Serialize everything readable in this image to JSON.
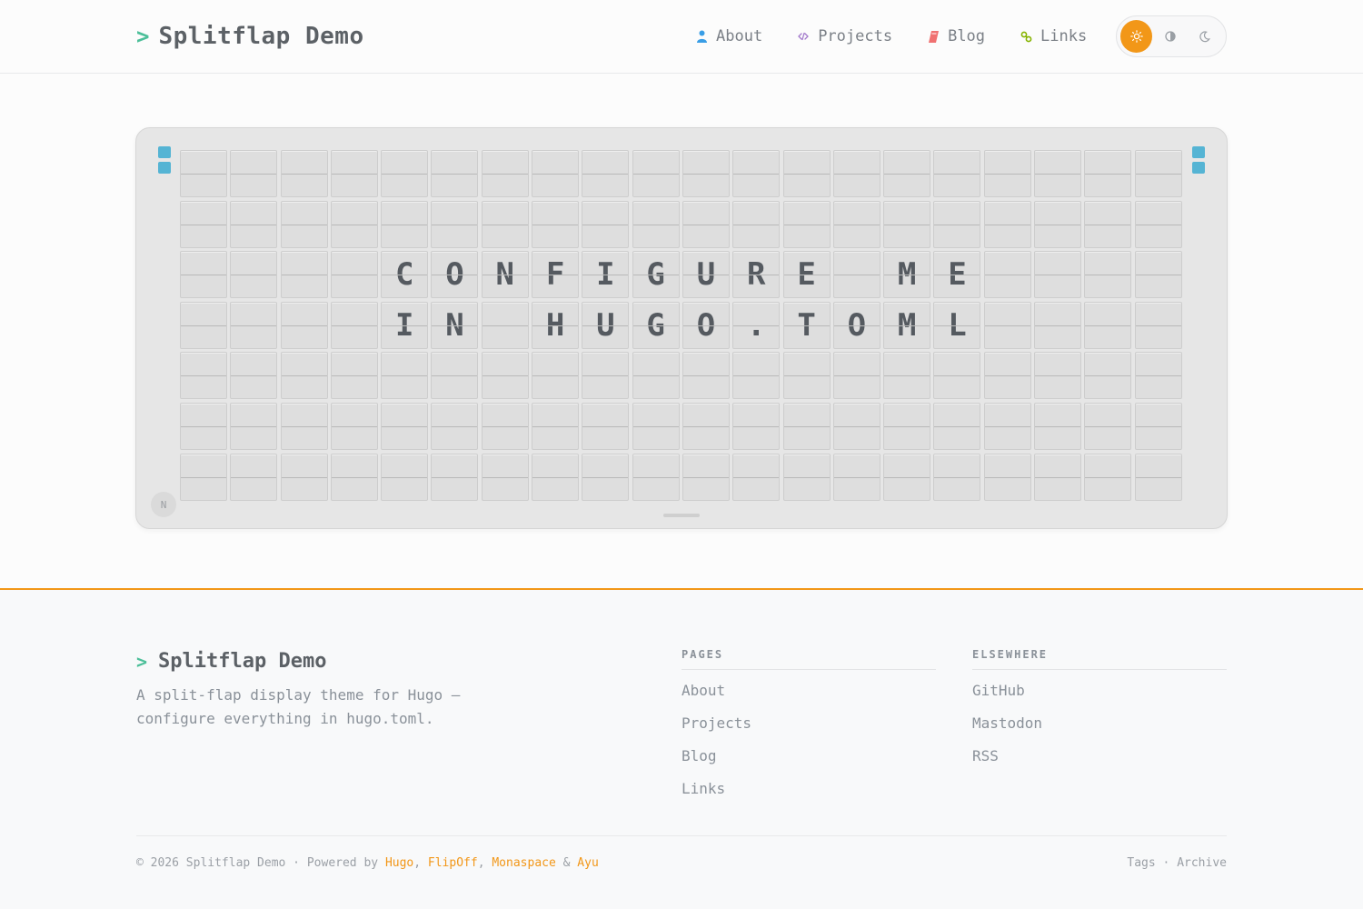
{
  "header": {
    "prompt": ">",
    "site_title": "Splitflap Demo",
    "nav": [
      {
        "label": "About",
        "icon": "person-icon",
        "color": "#399ee6"
      },
      {
        "label": "Projects",
        "icon": "code-icon",
        "color": "#a37acc"
      },
      {
        "label": "Blog",
        "icon": "notebook-icon",
        "color": "#f07171"
      },
      {
        "label": "Links",
        "icon": "link-icon",
        "color": "#86b300"
      }
    ],
    "theme_toggle": {
      "options": [
        "light",
        "auto",
        "dark"
      ],
      "selected": "light",
      "accent": "#f29718"
    }
  },
  "board": {
    "rows": [
      "                    ",
      "                    ",
      "    CONFIGURE ME    ",
      "    IN HUGO.TOML    ",
      "                    ",
      "                    ",
      "                    "
    ],
    "badge": "N",
    "led_color": "#55b4d4"
  },
  "footer": {
    "prompt": ">",
    "site_title": "Splitflap Demo",
    "description": "A split-flap display theme for Hugo — configure everything in hugo.toml.",
    "pages": {
      "heading": "PAGES",
      "items": [
        "About",
        "Projects",
        "Blog",
        "Links"
      ]
    },
    "elsewhere": {
      "heading": "ELSEWHERE",
      "items": [
        "GitHub",
        "Mastodon",
        "RSS"
      ]
    },
    "bottom": {
      "copyright": "© 2026 Splitflap Demo · Powered by ",
      "links": [
        "Hugo",
        "FlipOff",
        "Monaspace",
        "Ayu"
      ],
      "separators": [
        ", ",
        ", ",
        " & "
      ],
      "right": [
        "Tags",
        "Archive"
      ],
      "right_sep": " · "
    },
    "accent": "#f29718"
  }
}
